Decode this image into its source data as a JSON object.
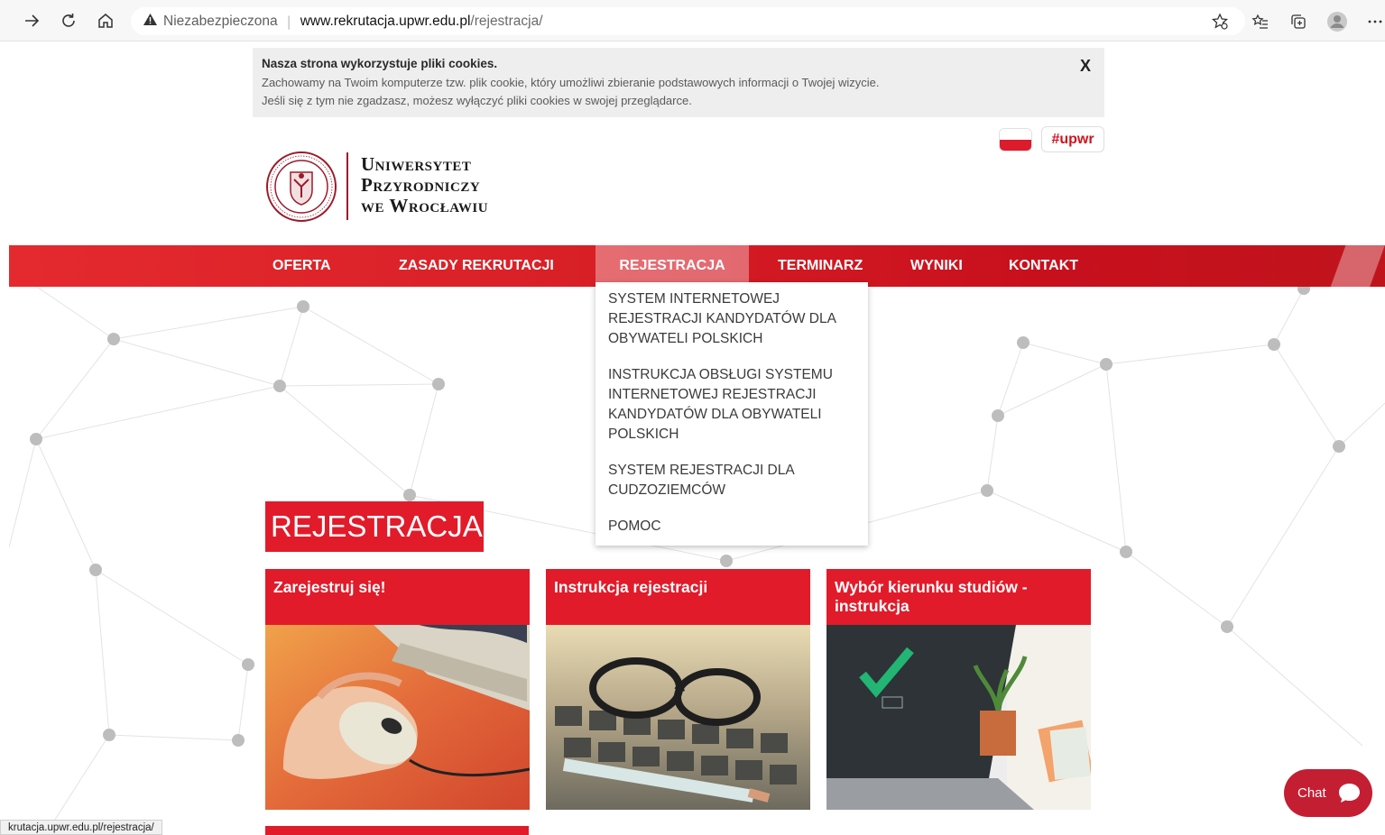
{
  "browser": {
    "security_label": "Niezabezpieczona",
    "url_domain": "www.rekrutacja.upwr.edu.pl",
    "url_path": "/rejestracja/",
    "status_url": "krutacja.upwr.edu.pl/rejestracja/"
  },
  "cookie": {
    "title": "Nasza strona wykorzystuje pliki cookies.",
    "line1": "Zachowamy na Twoim komputerze tzw. plik cookie, który umożliwi zbieranie podstawowych informacji o Twojej wizycie.",
    "line2": "Jeśli się z tym nie zgadzasz, możesz wyłączyć pliki cookies w swojej przeglądarce.",
    "close": "X"
  },
  "header": {
    "tag": "#upwr",
    "logo_line1": "Uniwersytet",
    "logo_line2": "Przyrodniczy",
    "logo_line3": "we Wrocławiu"
  },
  "menu": {
    "items": [
      {
        "label": "OFERTA"
      },
      {
        "label": "ZASADY REKRUTACJI"
      },
      {
        "label": "REJESTRACJA"
      },
      {
        "label": "TERMINARZ"
      },
      {
        "label": "WYNIKI"
      },
      {
        "label": "KONTAKT"
      }
    ],
    "active": "REJESTRACJA"
  },
  "dropdown": {
    "items": [
      {
        "label": "SYSTEM INTERNETOWEJ REJESTRACJI KANDYDATÓW DLA OBYWATELI POLSKICH"
      },
      {
        "label": "INSTRUKCJA OBSŁUGI SYSTEMU INTERNETOWEJ REJESTRACJI KANDYDATÓW DLA OBYWATELI POLSKICH"
      },
      {
        "label": "SYSTEM REJESTRACJI DLA CUDZOZIEMCÓW"
      },
      {
        "label": "POMOC"
      }
    ]
  },
  "main": {
    "heading": "REJESTRACJA",
    "cards": [
      {
        "title": "Zarejestruj się!"
      },
      {
        "title": "Instrukcja rejestracji"
      },
      {
        "title": "Wybór kierunku studiów - instrukcja"
      }
    ]
  },
  "chat": {
    "label": "Chat"
  },
  "colors": {
    "brand_red": "#e11b2a",
    "menu_red": "#d92027",
    "chat_red": "#c41e33"
  }
}
